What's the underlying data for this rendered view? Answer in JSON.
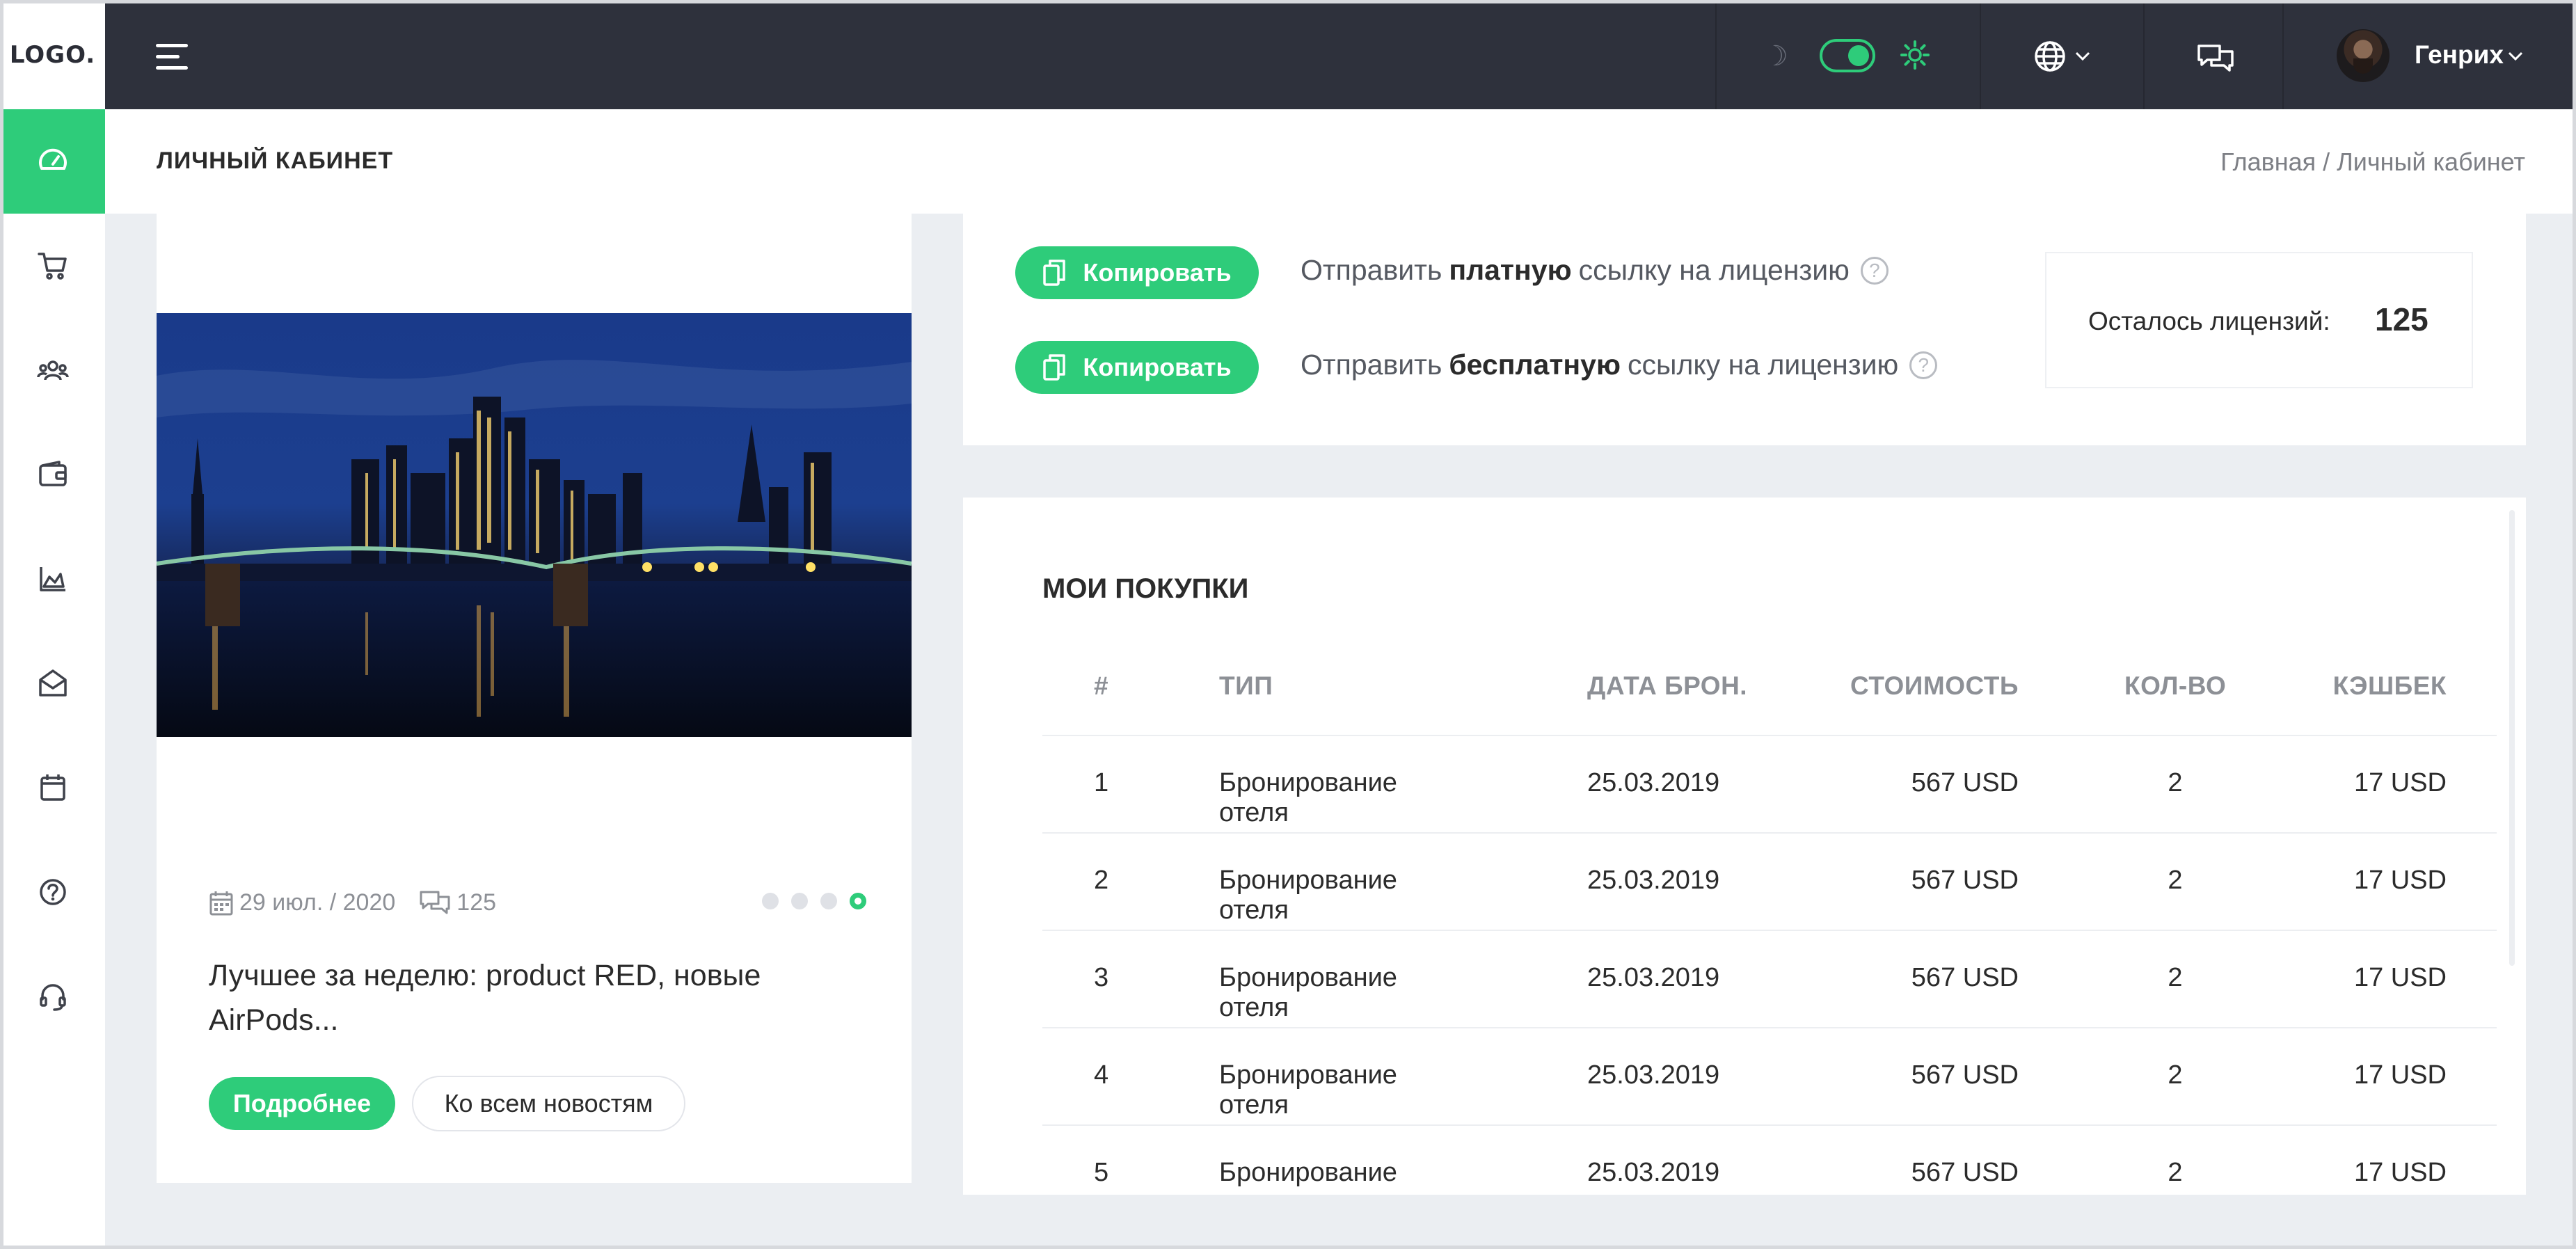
{
  "header": {
    "logo": "LOGO.",
    "user_name": "Генрих",
    "icons": [
      "menu-icon",
      "moon-icon",
      "theme-toggle",
      "sun-gear-icon",
      "globe-icon",
      "chat-icon",
      "chevron-down-icon"
    ]
  },
  "sidebar": {
    "items": [
      {
        "icon": "dashboard-icon",
        "active": true
      },
      {
        "icon": "cart-icon"
      },
      {
        "icon": "users-icon"
      },
      {
        "icon": "wallet-icon"
      },
      {
        "icon": "chart-icon"
      },
      {
        "icon": "mail-open-icon"
      },
      {
        "icon": "calendar-icon"
      },
      {
        "icon": "help-icon"
      },
      {
        "icon": "support-icon"
      }
    ]
  },
  "page": {
    "title": "ЛИЧНЫЙ КАБИНЕТ",
    "breadcrumb": {
      "home": "Главная",
      "separator": "/",
      "current": "Личный кабинет"
    }
  },
  "news": {
    "date": "29 июл. / 2020",
    "comments": "125",
    "title": "Лучшее за неделю: product RED, новые AirPods...",
    "more_button": "Подробнее",
    "all_button": "Ко всем новостям",
    "slides": 4,
    "active_slide": 4
  },
  "license": {
    "copy_label": "Копировать",
    "paid_prefix": "Отправить",
    "paid_bold": "платную",
    "paid_suffix": "ссылку на лицензию",
    "free_prefix": "Отправить",
    "free_bold": "бесплатную",
    "free_suffix": "ссылку на лицензию",
    "remaining_label": "Осталось лицензий:",
    "remaining_value": "125"
  },
  "purchases": {
    "title": "МОИ ПОКУПКИ",
    "columns": [
      "#",
      "ТИП",
      "ДАТА БРОН.",
      "СТОИМОСТЬ",
      "КОЛ-ВО",
      "КЭШБЕК"
    ],
    "rows": [
      [
        "1",
        "Бронирование отеля",
        "25.03.2019",
        "567 USD",
        "2",
        "17 USD"
      ],
      [
        "2",
        "Бронирование отеля",
        "25.03.2019",
        "567 USD",
        "2",
        "17 USD"
      ],
      [
        "3",
        "Бронирование отеля",
        "25.03.2019",
        "567 USD",
        "2",
        "17 USD"
      ],
      [
        "4",
        "Бронирование отеля",
        "25.03.2019",
        "567 USD",
        "2",
        "17 USD"
      ],
      [
        "5",
        "Бронирование отеля",
        "25.03.2019",
        "567 USD",
        "2",
        "17 USD"
      ]
    ]
  },
  "colors": {
    "accent": "#2ecc7a",
    "topbar": "#2e313c",
    "background": "#ebeef2"
  }
}
